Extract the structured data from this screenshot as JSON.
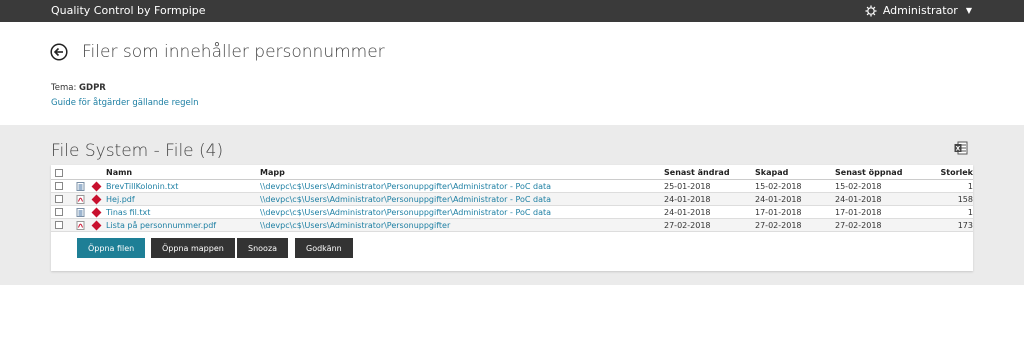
{
  "topbar": {
    "brand": "Quality Control by Formpipe",
    "user": "Administrator"
  },
  "header": {
    "title": "Filer som innehåller personnummer",
    "tema_label": "Tema:",
    "tema_value": "GDPR",
    "guide_link": "Guide för åtgärder gällande regeln"
  },
  "panel": {
    "title": "File System - File (4)"
  },
  "table": {
    "columns": [
      "Namn",
      "Mapp",
      "Senast ändrad",
      "Skapad",
      "Senast öppnad",
      "Storlek"
    ],
    "rows": [
      {
        "icon": "txt-file-icon",
        "name": "BrevTillKolonin.txt",
        "path": "\\\\devpc\\c$\\Users\\Administrator\\Personuppgifter\\Administrator - PoC data",
        "modified": "25-01-2018",
        "created": "15-02-2018",
        "opened": "15-02-2018",
        "size": "1"
      },
      {
        "icon": "pdf-file-icon",
        "name": "Hej.pdf",
        "path": "\\\\devpc\\c$\\Users\\Administrator\\Personuppgifter\\Administrator - PoC data",
        "modified": "24-01-2018",
        "created": "24-01-2018",
        "opened": "24-01-2018",
        "size": "158"
      },
      {
        "icon": "txt-file-icon",
        "name": "Tinas fil.txt",
        "path": "\\\\devpc\\c$\\Users\\Administrator\\Personuppgifter\\Administrator - PoC data",
        "modified": "24-01-2018",
        "created": "17-01-2018",
        "opened": "17-01-2018",
        "size": "1"
      },
      {
        "icon": "pdf-file-icon",
        "name": "Lista på personnummer.pdf",
        "path": "\\\\devpc\\c$\\Users\\Administrator\\Personuppgifter",
        "modified": "27-02-2018",
        "created": "27-02-2018",
        "opened": "27-02-2018",
        "size": "173"
      }
    ]
  },
  "actions": {
    "open_file": "Öppna filen",
    "open_folder": "Öppna mappen",
    "snooze": "Snooza",
    "approve": "Godkänn"
  },
  "colors": {
    "topbar": "#3a3a3a",
    "accent": "#1e7f96",
    "link": "#1d7fa3",
    "risk": "#c8102e"
  }
}
